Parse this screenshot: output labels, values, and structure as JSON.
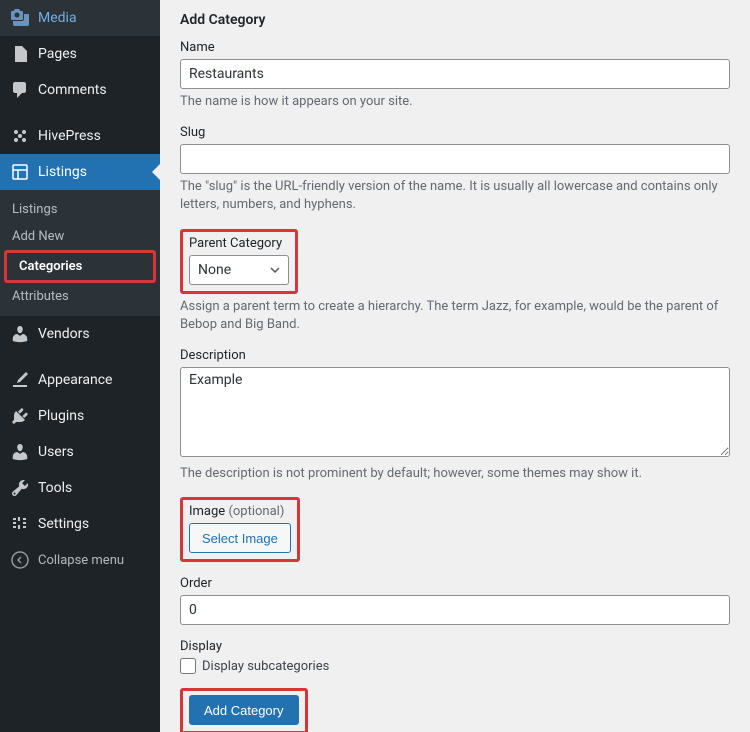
{
  "sidebar": {
    "items": [
      {
        "label": "Media",
        "icon": "media"
      },
      {
        "label": "Pages",
        "icon": "pages"
      },
      {
        "label": "Comments",
        "icon": "comments"
      },
      {
        "label": "HivePress",
        "icon": "hivepress"
      },
      {
        "label": "Listings",
        "icon": "listings"
      },
      {
        "label": "Vendors",
        "icon": "vendors"
      },
      {
        "label": "Appearance",
        "icon": "appearance"
      },
      {
        "label": "Plugins",
        "icon": "plugins"
      },
      {
        "label": "Users",
        "icon": "users"
      },
      {
        "label": "Tools",
        "icon": "tools"
      },
      {
        "label": "Settings",
        "icon": "settings"
      }
    ],
    "submenu": [
      {
        "label": "Listings"
      },
      {
        "label": "Add New"
      },
      {
        "label": "Categories"
      },
      {
        "label": "Attributes"
      }
    ],
    "collapse": "Collapse menu"
  },
  "form": {
    "title": "Add Category",
    "name": {
      "label": "Name",
      "value": "Restaurants",
      "help": "The name is how it appears on your site."
    },
    "slug": {
      "label": "Slug",
      "value": "",
      "help": "The \"slug\" is the URL-friendly version of the name. It is usually all lowercase and contains only letters, numbers, and hyphens."
    },
    "parent": {
      "label": "Parent Category",
      "value": "None",
      "help": "Assign a parent term to create a hierarchy. The term Jazz, for example, would be the parent of Bebop and Big Band."
    },
    "description": {
      "label": "Description",
      "value": "Example",
      "help": "The description is not prominent by default; however, some themes may show it."
    },
    "image": {
      "label": "Image ",
      "optional": "(optional)",
      "button": "Select Image"
    },
    "order": {
      "label": "Order",
      "value": "0"
    },
    "display": {
      "label": "Display",
      "checkbox": "Display subcategories"
    },
    "submit": "Add Category"
  }
}
